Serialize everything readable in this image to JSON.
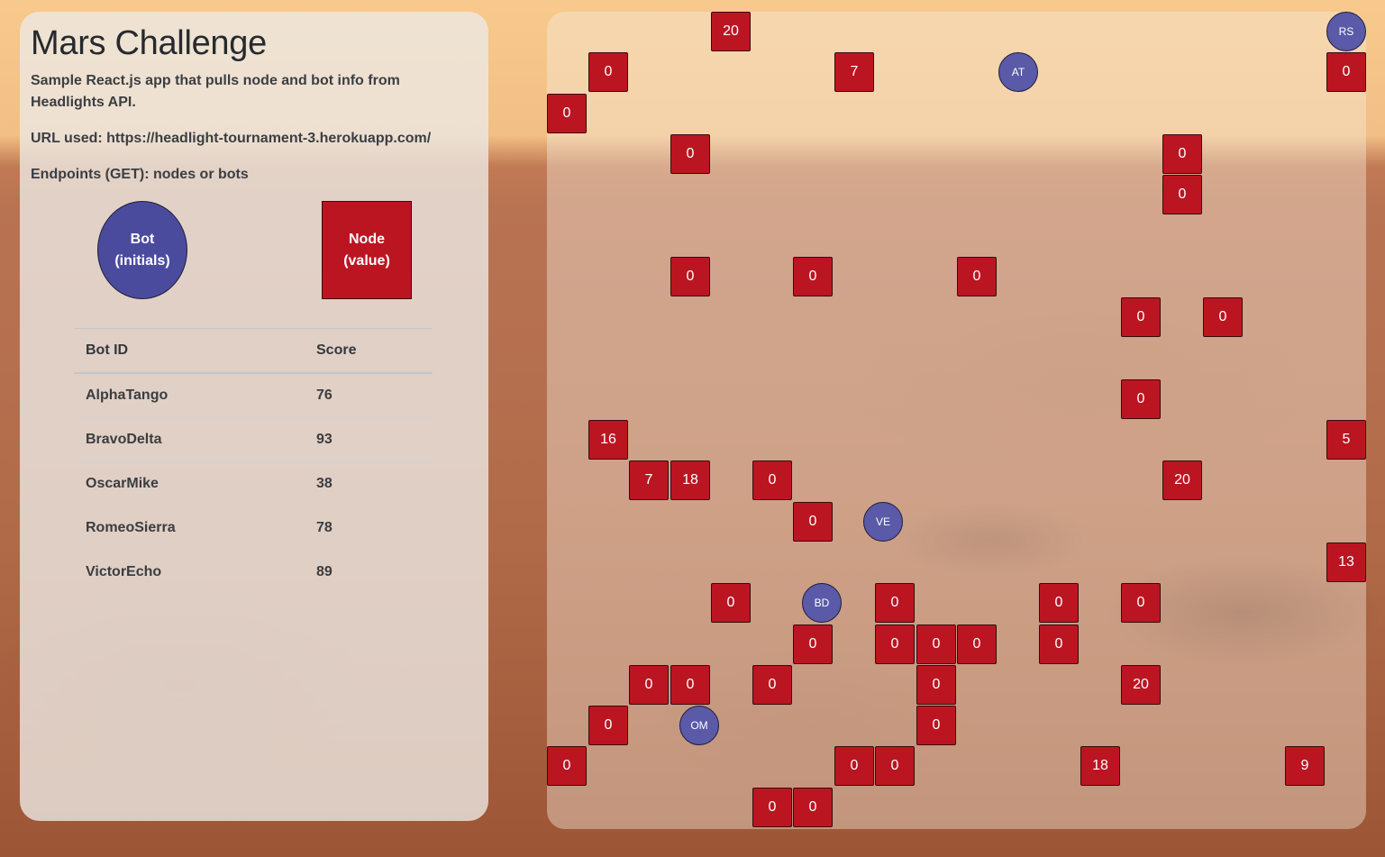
{
  "header": {
    "title": "Mars Challenge",
    "description": "Sample React.js app that pulls node and bot info from Headlights API.",
    "url_line": "URL used: https://headlight-tournament-3.herokuapp.com/",
    "endpoints_line": "Endpoints (GET): nodes or bots"
  },
  "legend": {
    "bot_label": "Bot\n(initials)",
    "node_label": "Node\n(value)",
    "bot_color": "#4b4b9e",
    "node_color": "#bc1522"
  },
  "table": {
    "columns": [
      "Bot ID",
      "Score"
    ],
    "rows": [
      {
        "id": "AlphaTango",
        "score": "76"
      },
      {
        "id": "BravoDelta",
        "score": "93"
      },
      {
        "id": "OscarMike",
        "score": "38"
      },
      {
        "id": "RomeoSierra",
        "score": "78"
      },
      {
        "id": "VictorEcho",
        "score": "89"
      }
    ]
  },
  "grid": {
    "nodes": [
      {
        "col": 4,
        "row": 0,
        "value": "20"
      },
      {
        "col": 1,
        "row": 1,
        "value": "0"
      },
      {
        "col": 7,
        "row": 1,
        "value": "7"
      },
      {
        "col": 19,
        "row": 1,
        "value": "0"
      },
      {
        "col": 0,
        "row": 2,
        "value": "0"
      },
      {
        "col": 3,
        "row": 3,
        "value": "0"
      },
      {
        "col": 15,
        "row": 3,
        "value": "0"
      },
      {
        "col": 15,
        "row": 4,
        "value": "0"
      },
      {
        "col": 3,
        "row": 6,
        "value": "0"
      },
      {
        "col": 6,
        "row": 6,
        "value": "0"
      },
      {
        "col": 10,
        "row": 6,
        "value": "0"
      },
      {
        "col": 14,
        "row": 7,
        "value": "0"
      },
      {
        "col": 16,
        "row": 7,
        "value": "0"
      },
      {
        "col": 14,
        "row": 9,
        "value": "0"
      },
      {
        "col": 1,
        "row": 10,
        "value": "16"
      },
      {
        "col": 19,
        "row": 10,
        "value": "5"
      },
      {
        "col": 2,
        "row": 11,
        "value": "7"
      },
      {
        "col": 3,
        "row": 11,
        "value": "18"
      },
      {
        "col": 5,
        "row": 11,
        "value": "0"
      },
      {
        "col": 15,
        "row": 11,
        "value": "20"
      },
      {
        "col": 6,
        "row": 12,
        "value": "0"
      },
      {
        "col": 19,
        "row": 13,
        "value": "13"
      },
      {
        "col": 4,
        "row": 14,
        "value": "0"
      },
      {
        "col": 8,
        "row": 14,
        "value": "0"
      },
      {
        "col": 12,
        "row": 14,
        "value": "0"
      },
      {
        "col": 14,
        "row": 14,
        "value": "0"
      },
      {
        "col": 6,
        "row": 15,
        "value": "0"
      },
      {
        "col": 8,
        "row": 15,
        "value": "0"
      },
      {
        "col": 9,
        "row": 15,
        "value": "0"
      },
      {
        "col": 10,
        "row": 15,
        "value": "0"
      },
      {
        "col": 12,
        "row": 15,
        "value": "0"
      },
      {
        "col": 2,
        "row": 16,
        "value": "0"
      },
      {
        "col": 3,
        "row": 16,
        "value": "0"
      },
      {
        "col": 5,
        "row": 16,
        "value": "0"
      },
      {
        "col": 9,
        "row": 16,
        "value": "0"
      },
      {
        "col": 14,
        "row": 16,
        "value": "20"
      },
      {
        "col": 1,
        "row": 17,
        "value": "0"
      },
      {
        "col": 9,
        "row": 17,
        "value": "0"
      },
      {
        "col": 0,
        "row": 18,
        "value": "0"
      },
      {
        "col": 7,
        "row": 18,
        "value": "0"
      },
      {
        "col": 8,
        "row": 18,
        "value": "0"
      },
      {
        "col": 13,
        "row": 18,
        "value": "18"
      },
      {
        "col": 18,
        "row": 18,
        "value": "9"
      },
      {
        "col": 5,
        "row": 19,
        "value": "0"
      },
      {
        "col": 6,
        "row": 19,
        "value": "0"
      }
    ],
    "bots": [
      {
        "col": 19,
        "row": 0,
        "initials": "RS"
      },
      {
        "col": 11,
        "row": 1,
        "initials": "AT"
      },
      {
        "col": 7,
        "row": 12,
        "initials": "VE",
        "offset": [
          -16,
          -4
        ]
      },
      {
        "col": 6,
        "row": 14,
        "initials": "BD",
        "offset": [
          -5,
          0
        ]
      },
      {
        "col": 3,
        "row": 17,
        "initials": "OM",
        "offset": [
          -5,
          0
        ]
      }
    ]
  }
}
